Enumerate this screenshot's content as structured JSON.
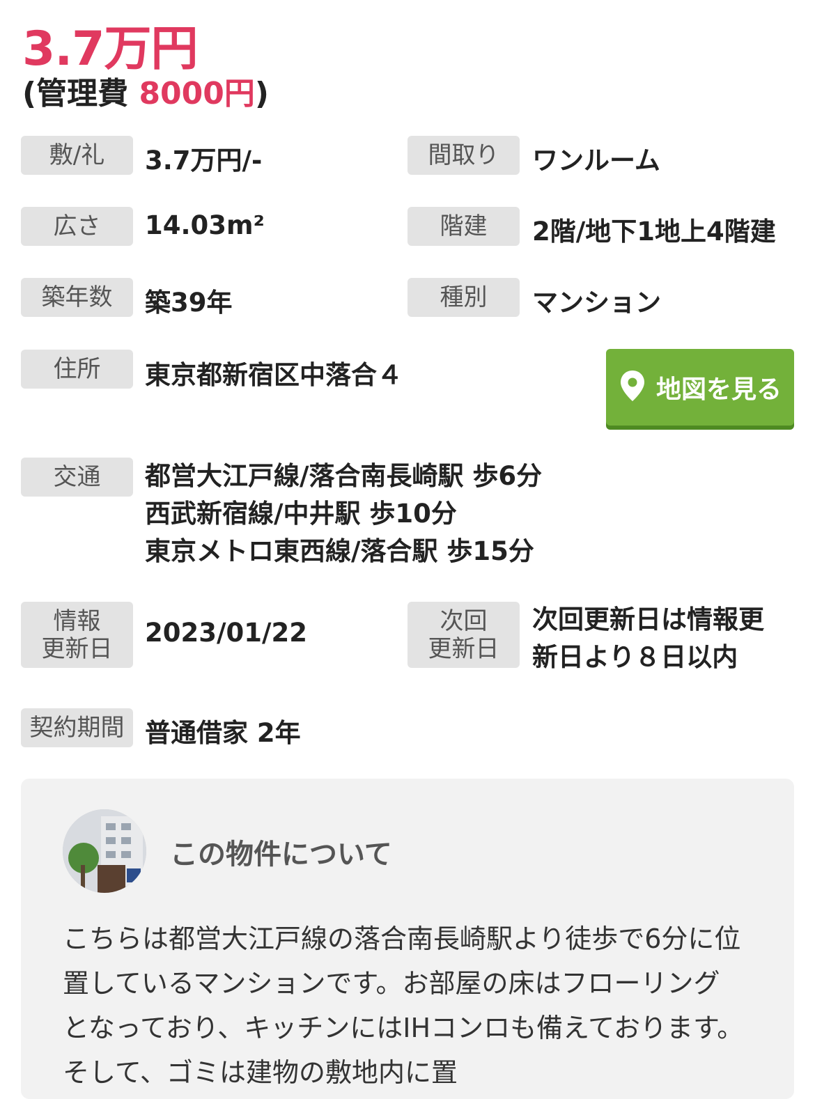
{
  "price": {
    "rent": "3.7万円",
    "mgmt_prefix": "(管理費 ",
    "mgmt_amount": "8000円",
    "mgmt_suffix": ")"
  },
  "details": {
    "deposit_key_label": "敷/礼",
    "deposit_key_value": "3.7万円/-",
    "layout_label": "間取り",
    "layout_value": "ワンルーム",
    "area_label": "広さ",
    "area_value": "14.03m²",
    "floor_label": "階建",
    "floor_value": "2階/地下1地上4階建",
    "age_label": "築年数",
    "age_value": "築39年",
    "type_label": "種別",
    "type_value": "マンション",
    "address_label": "住所",
    "address_value": "東京都新宿区中落合４",
    "traffic_label": "交通",
    "traffic_lines": [
      "都営大江戸線/落合南長崎駅 歩6分",
      "西武新宿線/中井駅 歩10分",
      "東京メトロ東西線/落合駅 歩15分"
    ],
    "updated_label": "情報\n更新日",
    "updated_value": "2023/01/22",
    "next_update_label": "次回\n更新日",
    "next_update_value_1": "次回更新日は情報更",
    "next_update_value_2": "新日より８日以内",
    "contract_label": "契約期間",
    "contract_value": "普通借家 2年"
  },
  "map_button": {
    "label": "地図を見る",
    "icon": "map-pin-icon"
  },
  "about": {
    "title": "この物件について",
    "description": "こちらは都営大江戸線の落合南長崎駅より徒歩で6分に位置しているマンションです。お部屋の床はフローリングとなっており、キッチンにはIHコンロも備えております。そして、ゴミは建物の敷地内に置"
  },
  "colors": {
    "accent": "#e0395f",
    "map_button": "#73b13a",
    "label_bg": "#e3e3e3"
  }
}
